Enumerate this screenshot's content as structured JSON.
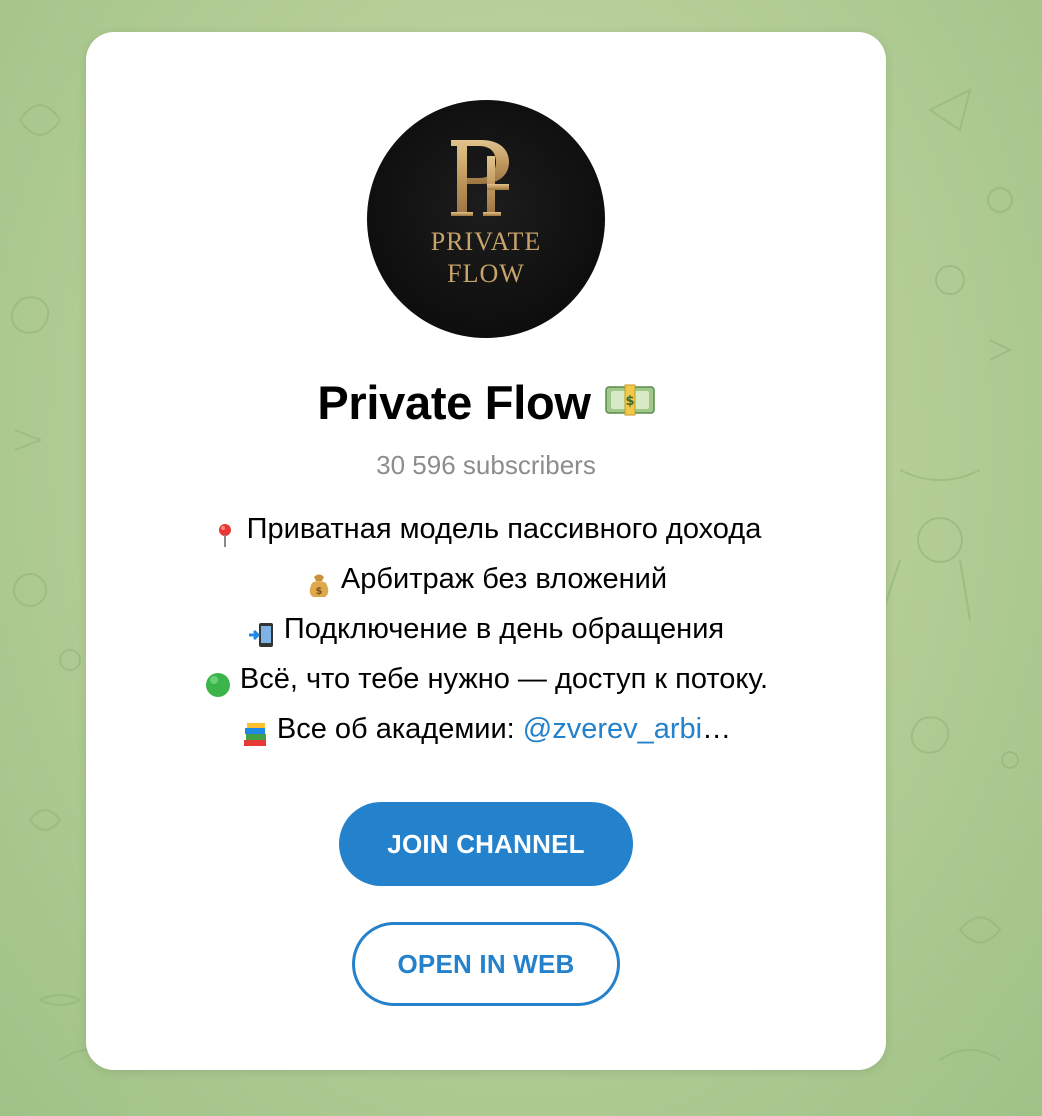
{
  "channel": {
    "name": "Private Flow",
    "name_emoji_icon": "dollar-banknote-icon",
    "subscribers": "30 596 subscribers",
    "avatar": {
      "monogram": "PF",
      "line1": "PRIVATE",
      "line2": "FLOW"
    }
  },
  "description": {
    "lines": [
      {
        "icon": "round-pushpin-icon",
        "text": "Приватная модель пассивного дохода"
      },
      {
        "icon": "money-bag-icon",
        "text": "Арбитраж без вложений"
      },
      {
        "icon": "mobile-phone-arrow-icon",
        "text": "Подключение в день обращения"
      },
      {
        "icon": "green-circle-icon",
        "text": "Всё, что тебе нужно — доступ к потоку."
      },
      {
        "icon": "books-icon",
        "text": "Все об академии: ",
        "link": "@zverev_arbi",
        "ellipsis": "…"
      }
    ]
  },
  "buttons": {
    "join": "JOIN CHANNEL",
    "web": "OPEN IN WEB"
  },
  "colors": {
    "accent": "#2481cc",
    "background": "#b7cf98",
    "card": "#ffffff",
    "avatar_gold": "#c8a46a"
  }
}
